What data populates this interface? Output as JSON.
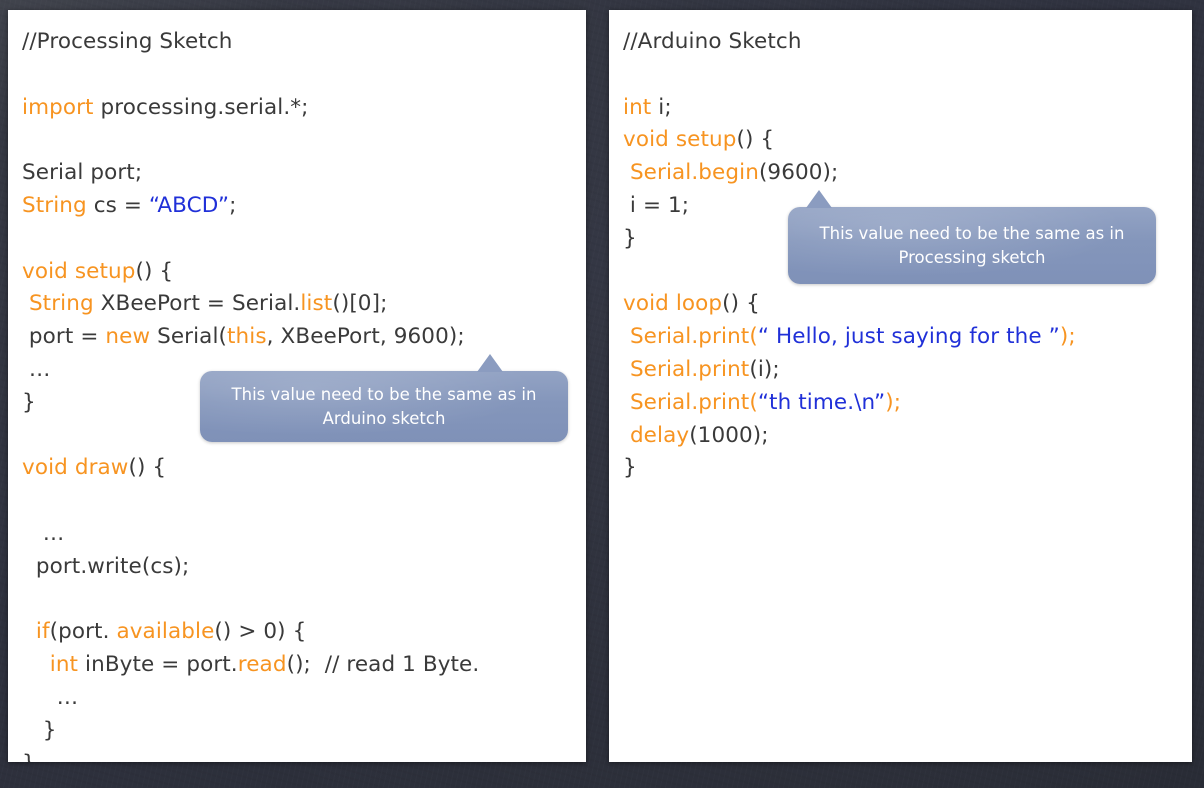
{
  "background": {
    "color": "#30333e",
    "description": "dark slate textured background"
  },
  "theme": {
    "panel_bg": "#ffffff",
    "code_default": "#3a3a3a",
    "keyword_orange": "#f79421",
    "string_blue": "#2030d8",
    "callout_bg": "#8496bb",
    "callout_text": "#ffffff"
  },
  "left_panel": {
    "name": "Processing Sketch code panel",
    "lines": [
      [
        {
          "t": "//Processing Sketch",
          "c": "cm"
        }
      ],
      [],
      [
        {
          "t": "import",
          "c": "kw"
        },
        {
          "t": " processing.serial.*;",
          "c": "pl"
        }
      ],
      [],
      [
        {
          "t": "Serial port;",
          "c": "pl"
        }
      ],
      [
        {
          "t": "String",
          "c": "kw"
        },
        {
          "t": " cs = ",
          "c": "pl"
        },
        {
          "t": "“ABCD”",
          "c": "str"
        },
        {
          "t": ";",
          "c": "pl"
        }
      ],
      [],
      [
        {
          "t": "void setup",
          "c": "kw"
        },
        {
          "t": "() {",
          "c": "pl"
        }
      ],
      [
        {
          "t": " ",
          "c": "pl"
        },
        {
          "t": "String",
          "c": "kw"
        },
        {
          "t": " XBeePort = Serial.",
          "c": "pl"
        },
        {
          "t": "list",
          "c": "kw"
        },
        {
          "t": "()[0];",
          "c": "pl"
        }
      ],
      [
        {
          "t": " port = ",
          "c": "pl"
        },
        {
          "t": "new",
          "c": "kw"
        },
        {
          "t": " Serial(",
          "c": "pl"
        },
        {
          "t": "this",
          "c": "kw"
        },
        {
          "t": ", XBeePort, 9600);",
          "c": "pl"
        }
      ],
      [
        {
          "t": " …",
          "c": "pl"
        }
      ],
      [
        {
          "t": "}",
          "c": "pl"
        }
      ],
      [],
      [
        {
          "t": "void draw",
          "c": "kw"
        },
        {
          "t": "() {",
          "c": "pl"
        }
      ],
      [],
      [
        {
          "t": "   …",
          "c": "pl"
        }
      ],
      [
        {
          "t": "  port.write(cs);",
          "c": "pl"
        }
      ],
      [],
      [
        {
          "t": "  ",
          "c": "pl"
        },
        {
          "t": "if",
          "c": "kw"
        },
        {
          "t": "(port. ",
          "c": "pl"
        },
        {
          "t": "available",
          "c": "kw"
        },
        {
          "t": "() > 0) {",
          "c": "pl"
        }
      ],
      [
        {
          "t": "    ",
          "c": "pl"
        },
        {
          "t": "int",
          "c": "kw"
        },
        {
          "t": " inByte = port.",
          "c": "pl"
        },
        {
          "t": "read",
          "c": "kw"
        },
        {
          "t": "();  // read 1 Byte.",
          "c": "pl"
        }
      ],
      [
        {
          "t": "     …",
          "c": "pl"
        }
      ],
      [
        {
          "t": "   }",
          "c": "pl"
        }
      ],
      [
        {
          "t": "}",
          "c": "pl"
        }
      ]
    ]
  },
  "right_panel": {
    "name": "Arduino Sketch code panel",
    "lines": [
      [
        {
          "t": "//Arduino Sketch",
          "c": "cm"
        }
      ],
      [],
      [
        {
          "t": "int",
          "c": "kw"
        },
        {
          "t": " i;",
          "c": "pl"
        }
      ],
      [
        {
          "t": "void setup",
          "c": "kw"
        },
        {
          "t": "() {",
          "c": "pl"
        }
      ],
      [
        {
          "t": " ",
          "c": "pl"
        },
        {
          "t": "Serial.begin",
          "c": "kw"
        },
        {
          "t": "(9600);",
          "c": "pl"
        }
      ],
      [
        {
          "t": " i = 1;",
          "c": "pl"
        }
      ],
      [
        {
          "t": "}",
          "c": "pl"
        }
      ],
      [],
      [
        {
          "t": "void loop",
          "c": "kw"
        },
        {
          "t": "() {",
          "c": "pl"
        }
      ],
      [
        {
          "t": " ",
          "c": "pl"
        },
        {
          "t": "Serial.print(",
          "c": "kw"
        },
        {
          "t": "“ Hello, just saying for the ”",
          "c": "str"
        },
        {
          "t": ");",
          "c": "kw"
        }
      ],
      [
        {
          "t": " ",
          "c": "pl"
        },
        {
          "t": "Serial.print",
          "c": "kw"
        },
        {
          "t": "(i);",
          "c": "pl"
        }
      ],
      [
        {
          "t": " ",
          "c": "pl"
        },
        {
          "t": "Serial.print(",
          "c": "kw"
        },
        {
          "t": "“th time.\\n”",
          "c": "str"
        },
        {
          "t": ");",
          "c": "kw"
        }
      ],
      [
        {
          "t": " ",
          "c": "pl"
        },
        {
          "t": "delay",
          "c": "kw"
        },
        {
          "t": "(1000);",
          "c": "pl"
        }
      ],
      [
        {
          "t": "}",
          "c": "pl"
        }
      ]
    ]
  },
  "callouts": {
    "left": {
      "text": "This value need to be the same as in Arduino sketch",
      "points_at": "9600 in new Serial(this, XBeePort, 9600);"
    },
    "right": {
      "text": "This value need to be the same as in Processing sketch",
      "points_at": "9600 in Serial.begin(9600);"
    }
  }
}
